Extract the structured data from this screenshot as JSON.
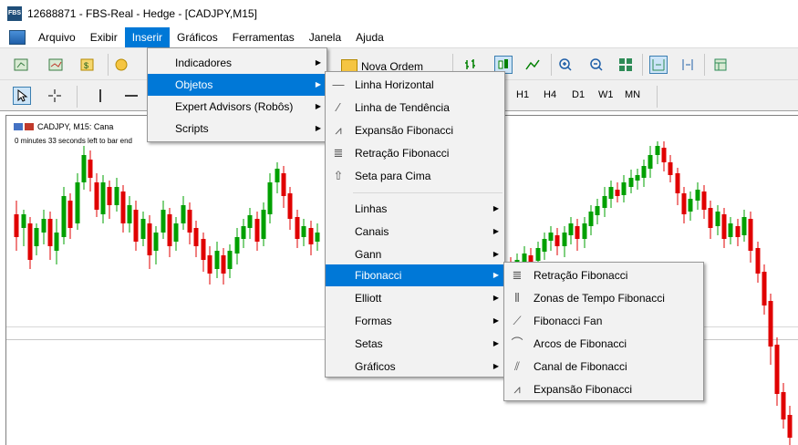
{
  "window": {
    "title": "12688871 - FBS-Real - Hedge - [CADJPY,M15]"
  },
  "menubar": [
    "Arquivo",
    "Exibir",
    "Inserir",
    "Gráficos",
    "Ferramentas",
    "Janela",
    "Ajuda"
  ],
  "toolbar": {
    "new_order": "Nova Ordem",
    "timeframes": [
      "H1",
      "H4",
      "D1",
      "W1",
      "MN"
    ]
  },
  "chart": {
    "label": "CADJPY, M15: Cana",
    "countdown": "0 minutes 33 seconds left to bar end",
    "colors": {
      "bull": "#00a000",
      "bear": "#e00000",
      "grid": "#c0c0c0"
    }
  },
  "insert_menu": [
    {
      "label": "Indicadores",
      "submenu": true
    },
    {
      "label": "Objetos",
      "submenu": true,
      "highlighted": true
    },
    {
      "label": "Expert Advisors (Robôs)",
      "submenu": true
    },
    {
      "label": "Scripts",
      "submenu": true
    }
  ],
  "objects_menu": {
    "top": [
      {
        "label": "Linha Horizontal",
        "icon": "horizontal-line-icon"
      },
      {
        "label": "Linha de Tendência",
        "icon": "trendline-icon"
      },
      {
        "label": "Expansão Fibonacci",
        "icon": "fibo-expansion-icon"
      },
      {
        "label": "Retração Fibonacci",
        "icon": "fibo-retracement-icon"
      },
      {
        "label": "Seta para Cima",
        "icon": "arrow-up-icon"
      }
    ],
    "bottom": [
      {
        "label": "Linhas"
      },
      {
        "label": "Canais"
      },
      {
        "label": "Gann"
      },
      {
        "label": "Fibonacci",
        "highlighted": true
      },
      {
        "label": "Elliott"
      },
      {
        "label": "Formas"
      },
      {
        "label": "Setas"
      },
      {
        "label": "Gráficos"
      }
    ]
  },
  "fibonacci_menu": [
    {
      "label": "Retração Fibonacci",
      "icon": "fibo-retracement-icon"
    },
    {
      "label": "Zonas de Tempo Fibonacci",
      "icon": "fibo-timezones-icon"
    },
    {
      "label": "Fibonacci Fan",
      "icon": "fibo-fan-icon"
    },
    {
      "label": "Arcos de Fibonacci",
      "icon": "fibo-arcs-icon"
    },
    {
      "label": "Canal de Fibonacci",
      "icon": "fibo-channel-icon"
    },
    {
      "label": "Expansão Fibonacci",
      "icon": "fibo-expansion-icon"
    }
  ]
}
